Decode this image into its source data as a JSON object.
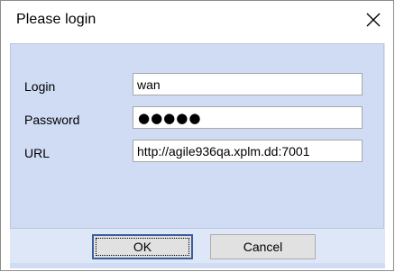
{
  "dialog": {
    "title": "Please login"
  },
  "form": {
    "login_label": "Login",
    "login_value": "wan",
    "password_label": "Password",
    "password_mask": "●●●●●",
    "url_label": "URL",
    "url_value": "http://agile936qa.xplm.dd:7001"
  },
  "buttons": {
    "ok_label": "OK",
    "cancel_label": "Cancel"
  },
  "colors": {
    "panel_bg": "#cfdcf4",
    "body_bg": "#dde7f8",
    "button_bg": "#e1e1e1",
    "default_button_border": "#3a5f9a"
  },
  "icons": {
    "close": "close-icon"
  }
}
